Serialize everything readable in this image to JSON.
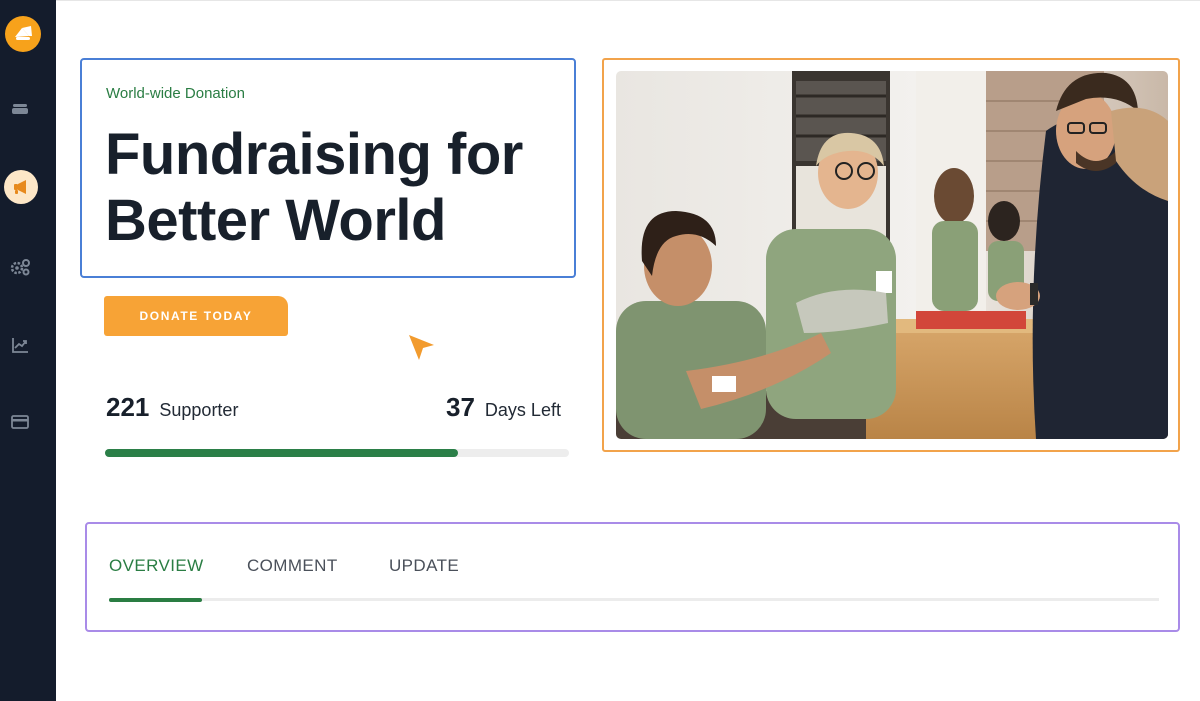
{
  "nav": {
    "items": [
      {
        "icon": "layers-icon"
      },
      {
        "icon": "megaphone-icon",
        "active": true
      },
      {
        "icon": "gears-icon"
      },
      {
        "icon": "chart-icon"
      },
      {
        "icon": "card-icon"
      }
    ]
  },
  "hero": {
    "eyebrow": "World-wide Donation",
    "title": "Fundraising for Better World",
    "cta_label": "DONATE TODAY"
  },
  "stats": {
    "supporters_count": "221",
    "supporters_label": "Supporter",
    "days_count": "37",
    "days_label": "Days Left",
    "progress_fraction": 0.76
  },
  "tabs": [
    {
      "label": "OVERVIEW",
      "active": true
    },
    {
      "label": "COMMENT",
      "active": false
    },
    {
      "label": "UPDATE",
      "active": false
    }
  ],
  "colors": {
    "sidebar": "#141c2c",
    "accent_orange": "#f7a336",
    "accent_green": "#2a7d43",
    "hero_border": "#4a7fd6",
    "photo_border": "#f2a34b",
    "tabs_border": "#a98be8"
  }
}
